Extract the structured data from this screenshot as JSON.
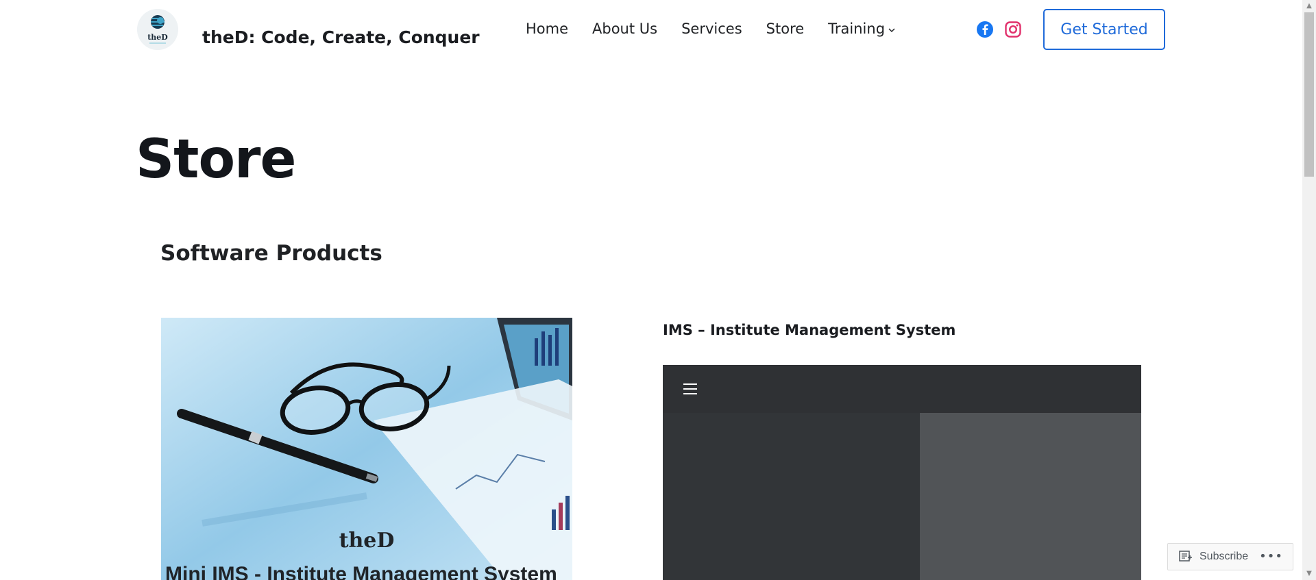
{
  "site": {
    "title": "theD: Code, Create, Conquer",
    "logo_text": "theD"
  },
  "nav": {
    "items": [
      {
        "label": "Home"
      },
      {
        "label": "About Us"
      },
      {
        "label": "Services"
      },
      {
        "label": "Store"
      },
      {
        "label": "Training",
        "has_dropdown": true
      }
    ]
  },
  "social": {
    "icons": [
      "facebook-icon",
      "instagram-icon"
    ],
    "colors": {
      "facebook": "#1877f2",
      "instagram": "#e4405f"
    }
  },
  "header": {
    "cta_label": "Get Started",
    "cta_color": "#1f6ad9"
  },
  "main": {
    "page_title": "Store",
    "section_heading": "Software Products",
    "products": [
      {
        "image_brand": "theD",
        "image_caption": "Mini IMS - Institute Management System"
      },
      {
        "title": "IMS – Institute Management System"
      }
    ]
  },
  "widget": {
    "subscribe_label": "Subscribe",
    "more_label": "•••"
  }
}
